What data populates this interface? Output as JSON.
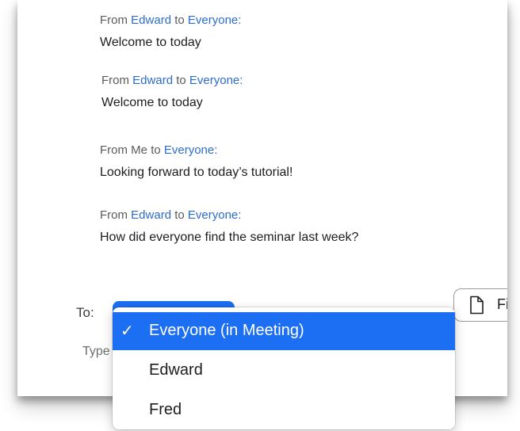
{
  "chat": {
    "messages": [
      {
        "prefix": "From",
        "sender": "Edward",
        "mid": "to",
        "recipient": "Everyone:",
        "text": "Welcome to today"
      },
      {
        "prefix": "From",
        "sender": "Edward",
        "mid": "to",
        "recipient": "Everyone:",
        "text": "Welcome to today"
      },
      {
        "prefix": "From",
        "sender": "Me",
        "mid": "to",
        "recipient": "Everyone:",
        "text": "Looking forward to today’s tutorial!"
      },
      {
        "prefix": "From",
        "sender": "Edward",
        "mid": "to",
        "recipient": "Everyone:",
        "text": "How did everyone find the seminar last week?"
      }
    ]
  },
  "composer": {
    "to_label": "To:",
    "type_hint": "Type",
    "file_label": "Fi",
    "file_icon": "document-icon"
  },
  "recipient_menu": {
    "items": [
      {
        "label": "Everyone (in Meeting)",
        "selected": true,
        "check": "✓"
      },
      {
        "label": "Edward",
        "selected": false
      },
      {
        "label": "Fred",
        "selected": false
      }
    ]
  },
  "colors": {
    "accent": "#1c6ef2",
    "link": "#2d6cc8",
    "muted_text": "#5a5a5a"
  }
}
